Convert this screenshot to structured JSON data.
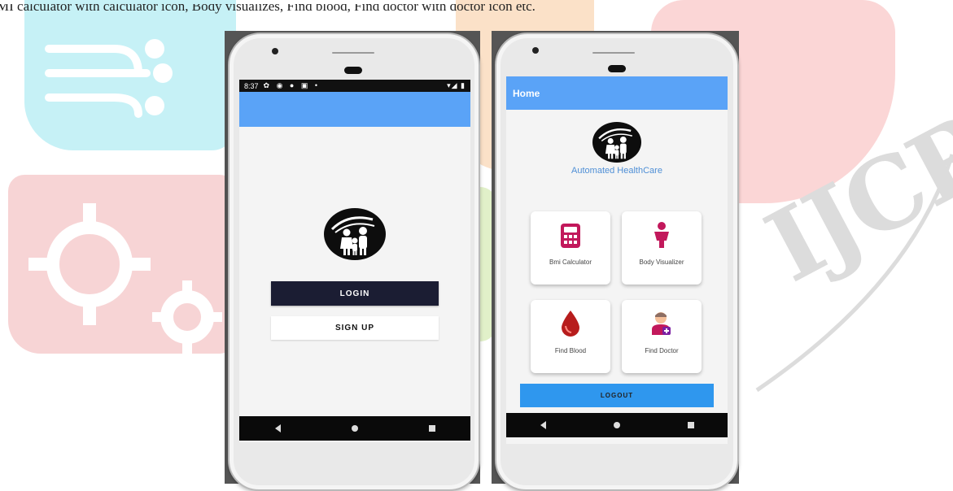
{
  "caption": "MI calculator with calculator icon, Body visualizes, Find blood, Find doctor with doctor icon etc.",
  "watermark": "IJCRT",
  "colors": {
    "appbar": "#5aa3f7",
    "login_button": "#1b1d33",
    "logout_button": "#2f97ee",
    "title_text": "#4f8fd6"
  },
  "phone1": {
    "status": {
      "time": "8:37",
      "icons": "✿ ◉ ● ▣ •",
      "right": "▾◢ ▮"
    },
    "login_label": "LOGIN",
    "signup_label": "SIGN UP",
    "nav": {
      "back": "back-icon",
      "home": "home-icon",
      "recent": "recent-apps-icon"
    }
  },
  "phone2": {
    "appbar_title": "Home",
    "app_title": "Automated HealthCare",
    "cards": [
      {
        "label": "Bmi Calculator",
        "icon": "calculator-icon"
      },
      {
        "label": "Body Visualizer",
        "icon": "person-icon"
      },
      {
        "label": "Find Blood",
        "icon": "blood-drop-icon"
      },
      {
        "label": "Find Doctor",
        "icon": "doctor-icon"
      }
    ],
    "logout_label": "LOGOUT"
  }
}
